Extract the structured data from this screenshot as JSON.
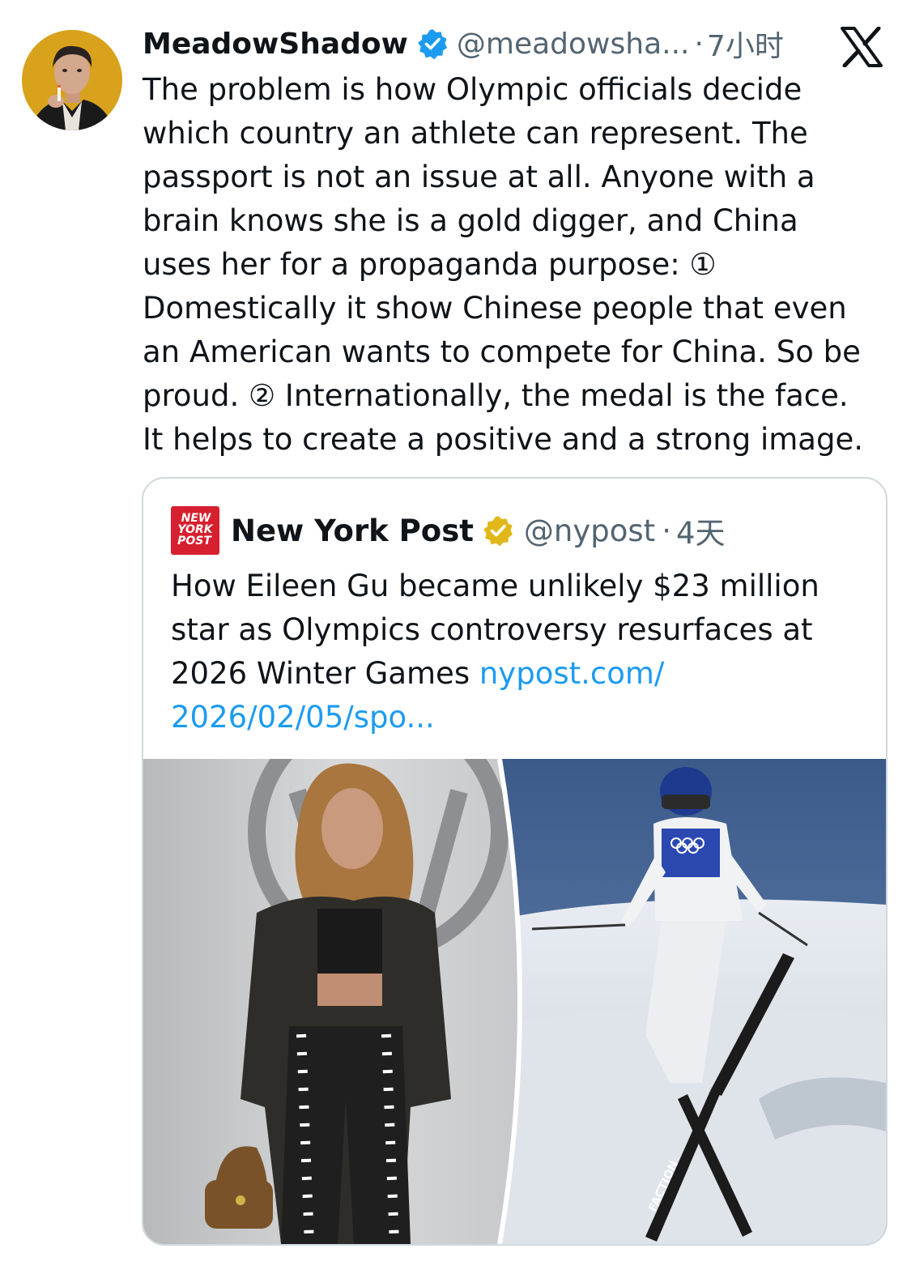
{
  "author": {
    "display_name": "MeadowShadow",
    "handle": "@meadowsha...",
    "separator": "·",
    "time": "7小时",
    "avatar_icon": "portrait-avatar",
    "verified_icon": "blue-verified-badge"
  },
  "platform": {
    "logo_icon": "x-logo"
  },
  "tweet": {
    "lines": [
      "The problem is how Olympic officials decide",
      "which country an athlete can represent. The",
      "passport is not an issue at all. Anyone with a",
      "brain knows she is a gold digger, and China",
      "uses her for a propaganda purpose: ①",
      "Domestically it show Chinese people that even",
      "an American wants to compete for China. So be",
      "proud. ② Internationally, the medal is the face.",
      "It helps to create a positive and a strong image."
    ]
  },
  "quote": {
    "logo_icon": "new-york-post-logo",
    "logo_text": [
      "NEW",
      "YORK",
      "POST"
    ],
    "display_name": "New York Post",
    "handle": "@nypost",
    "separator": "·",
    "time": "4天",
    "verified_icon": "gold-verified-badge",
    "text_lines": [
      "How Eileen Gu became unlikely $23 million",
      "star as Olympics controversy resurfaces at"
    ],
    "text_last_plain": "2026 Winter Games ",
    "link_line1": "nypost.com/",
    "link_line2": "2026/02/05/spo...",
    "media": {
      "left_description_icon": "fashion-photo",
      "right_description_icon": "freestyle-ski-photo",
      "olympic_rings_icon": "olympic-rings",
      "ski_brand": "FACTION"
    }
  },
  "colors": {
    "text": "#0f1419",
    "secondary": "#536471",
    "link": "#1d9bf0",
    "verified_blue": "#1d9bf0",
    "verified_gold": "#e2b719",
    "nypost_red": "#d6202f",
    "border": "#cfd9de"
  }
}
